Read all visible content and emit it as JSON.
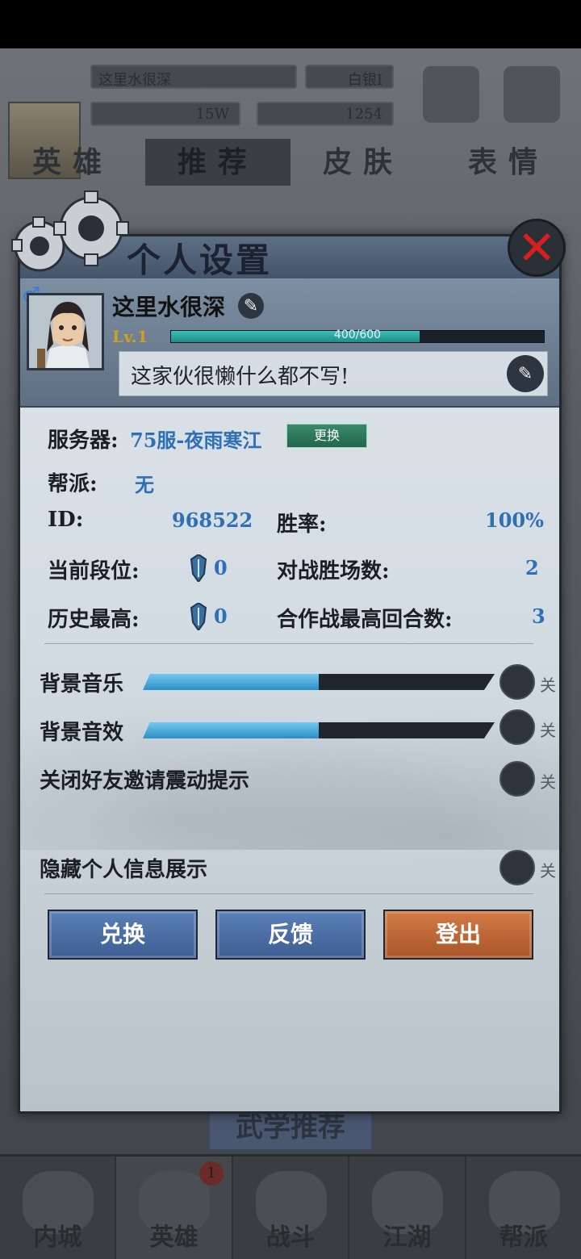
{
  "background": {
    "top_name": "这里水很深",
    "top_rank": "白银Ⅰ",
    "currency_1": "15W",
    "currency_2": "1254",
    "tabs": [
      "英雄",
      "推荐",
      "皮肤",
      "表情"
    ],
    "recommend_button": "武学推荐",
    "nav": [
      "内城",
      "英雄",
      "战斗",
      "江湖",
      "帮派"
    ],
    "nav_badge": "1"
  },
  "dialog": {
    "title": "个人设置",
    "close_label": "✕"
  },
  "profile": {
    "nickname": "这里水很深",
    "level": "Lv.1",
    "exp_text": "400/600",
    "exp_fraction": 0.6667,
    "signature": "这家伙很懒什么都不写!"
  },
  "info": {
    "server_label": "服务器:",
    "server_value": "75服-夜雨寒江",
    "swap_label": "更换",
    "guild_label": "帮派:",
    "guild_value": "无",
    "id_label": "ID:",
    "id_value": "968522",
    "winrate_label": "胜率:",
    "winrate_value": "100%",
    "rank_label": "当前段位:",
    "rank_value": "0",
    "wins_label": "对战胜场数:",
    "wins_value": "2",
    "best_label": "历史最高:",
    "best_value": "0",
    "coop_label": "合作战最高回合数:",
    "coop_value": "3"
  },
  "settings": {
    "music_label": "背景音乐",
    "music_level": 0.5,
    "music_toggle": "关",
    "sfx_label": "背景音效",
    "sfx_level": 0.5,
    "sfx_toggle": "关",
    "vibrate_label": "关闭好友邀请震动提示",
    "vibrate_toggle": "关",
    "hide_label": "隐藏个人信息展示",
    "hide_toggle": "关"
  },
  "buttons": {
    "redeem": "兑换",
    "feedback": "反馈",
    "logout": "登出"
  },
  "colors": {
    "accent_blue": "#2f6fb4",
    "close_red": "#d71f1f",
    "logout_orange": "#c06a38"
  }
}
